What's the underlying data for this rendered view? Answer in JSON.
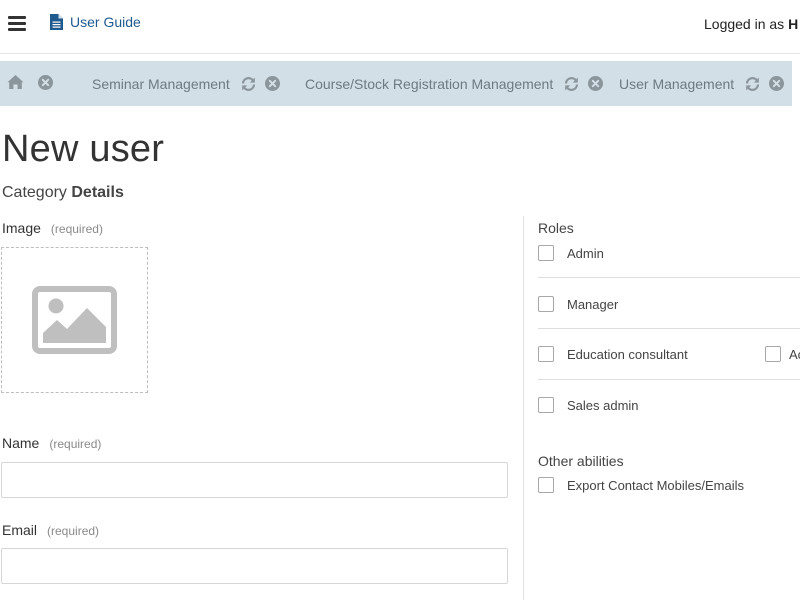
{
  "header": {
    "menu_icon": "hamburger-icon",
    "guide_icon": "document-icon",
    "guide_label": "User Guide",
    "logged_in_prefix": "Logged in as ",
    "logged_in_user": "H"
  },
  "tabs": {
    "home_icon": "home-icon",
    "close_icon": "close-circle-icon",
    "refresh_icon": "refresh-icon",
    "items": [
      {
        "label": "Seminar Management"
      },
      {
        "label": "Course/Stock Registration Management"
      },
      {
        "label": "User Management"
      }
    ]
  },
  "page": {
    "title": "New user",
    "breadcrumb_prefix": "Category",
    "breadcrumb_current": "Details"
  },
  "form": {
    "image_label": "Image",
    "image_required": "(required)",
    "image_placeholder_icon": "image-placeholder-icon",
    "name_label": "Name",
    "name_required": "(required)",
    "name_value": "",
    "email_label": "Email",
    "email_required": "(required)",
    "email_value": ""
  },
  "roles": {
    "title": "Roles",
    "items": [
      {
        "label": "Admin",
        "checked": false
      },
      {
        "label": "Manager",
        "checked": false
      },
      {
        "label": "Education consultant",
        "checked": false
      },
      {
        "label": "Sales admin",
        "checked": false
      }
    ],
    "extra_item": {
      "label": "Ac",
      "checked": false
    }
  },
  "abilities": {
    "title": "Other abilities",
    "items": [
      {
        "label": "Export Contact Mobiles/Emails",
        "checked": false
      }
    ]
  },
  "colors": {
    "link": "#1f5a8f",
    "tab_strip": "#d3dfe6",
    "tab_text": "#6e7a82",
    "icon_gray": "#8b959c"
  }
}
